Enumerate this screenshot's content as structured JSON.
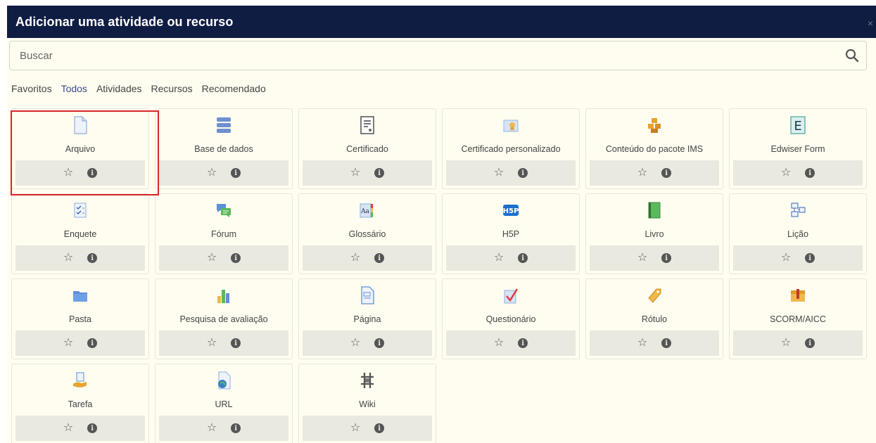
{
  "modal": {
    "title": "Adicionar uma atividade ou recurso",
    "close": "×"
  },
  "search": {
    "placeholder": "Buscar"
  },
  "tabs": [
    "Favoritos",
    "Todos",
    "Atividades",
    "Recursos",
    "Recomendado"
  ],
  "active_tab": "Todos",
  "items": [
    {
      "label": "Arquivo",
      "icon": "file-icon"
    },
    {
      "label": "Base de dados",
      "icon": "database-icon"
    },
    {
      "label": "Certificado",
      "icon": "certificate-icon"
    },
    {
      "label": "Certificado personalizado",
      "icon": "custom-certificate-icon"
    },
    {
      "label": "Conteúdo do pacote IMS",
      "icon": "ims-package-icon"
    },
    {
      "label": "Edwiser Form",
      "icon": "edwiser-form-icon"
    },
    {
      "label": "Enquete",
      "icon": "poll-icon"
    },
    {
      "label": "Fórum",
      "icon": "forum-icon"
    },
    {
      "label": "Glossário",
      "icon": "glossary-icon"
    },
    {
      "label": "H5P",
      "icon": "h5p-icon"
    },
    {
      "label": "Livro",
      "icon": "book-icon"
    },
    {
      "label": "Lição",
      "icon": "lesson-icon"
    },
    {
      "label": "Pasta",
      "icon": "folder-icon"
    },
    {
      "label": "Pesquisa de avaliação",
      "icon": "feedback-icon"
    },
    {
      "label": "Página",
      "icon": "page-icon"
    },
    {
      "label": "Questionário",
      "icon": "quiz-icon"
    },
    {
      "label": "Rótulo",
      "icon": "label-icon"
    },
    {
      "label": "SCORM/AICC",
      "icon": "scorm-icon"
    },
    {
      "label": "Tarefa",
      "icon": "assignment-icon"
    },
    {
      "label": "URL",
      "icon": "url-icon"
    },
    {
      "label": "Wiki",
      "icon": "wiki-icon"
    }
  ],
  "highlighted_item": "Arquivo",
  "colors": {
    "header": "#0f1d43",
    "active_tab": "#3b4a8a",
    "highlight": "#d9252a",
    "background": "#fefdf0"
  }
}
